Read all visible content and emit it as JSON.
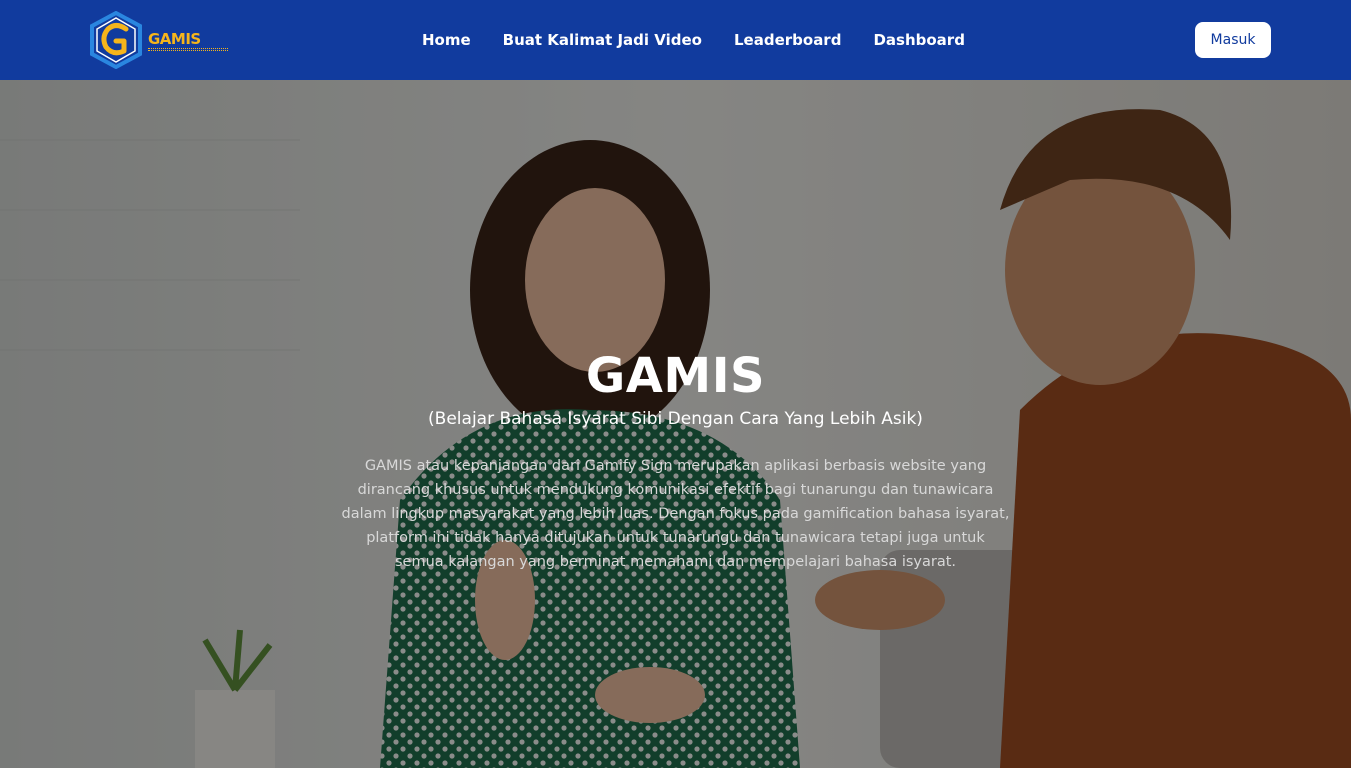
{
  "header": {
    "logo_text": "GAMIS",
    "nav": [
      {
        "label": "Home"
      },
      {
        "label": "Buat Kalimat Jadi Video"
      },
      {
        "label": "Leaderboard"
      },
      {
        "label": "Dashboard"
      }
    ],
    "login_label": "Masuk"
  },
  "hero": {
    "title": "GAMIS",
    "subtitle": "(Belajar Bahasa Isyarat Sibi Dengan Cara Yang Lebih Asik)",
    "description": "GAMIS atau kepanjangan dari Gamify Sign merupakan aplikasi berbasis website yang dirancang khusus untuk mendukung komunikasi efektif bagi tunarungu dan tunawicara dalam lingkup masyarakat yang lebih luas. Dengan fokus pada gamification bahasa isyarat, platform ini tidak hanya ditujukan untuk tunarungu dan tunawicara tetapi juga untuk semua kalangan yang berminat memahami dan mempelajari bahasa isyarat."
  },
  "colors": {
    "navbar": "#113b9e",
    "accent": "#f6b51b",
    "white": "#ffffff"
  }
}
